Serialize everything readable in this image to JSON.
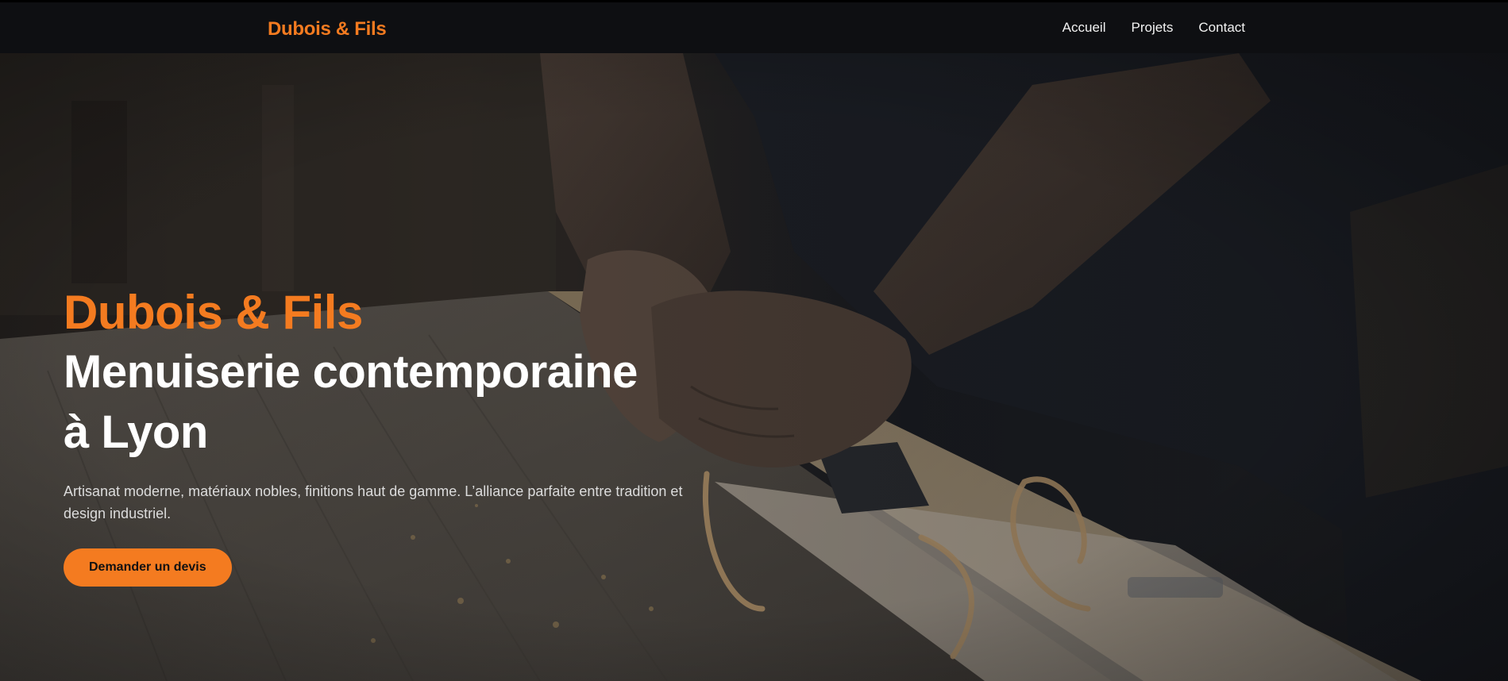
{
  "colors": {
    "accent": "#f47b20",
    "nav_background": "#0e0f12",
    "title_text": "#ffffff",
    "body_text": "#dcdcdc"
  },
  "navbar": {
    "brand": "Dubois & Fils",
    "links": [
      {
        "label": "Accueil"
      },
      {
        "label": "Projets"
      },
      {
        "label": "Contact"
      }
    ]
  },
  "hero": {
    "brand_heading": "Dubois & Fils",
    "title": "Menuiserie contemporaine à Lyon",
    "description": "Artisanat moderne, matériaux nobles, finitions haut de gamme. L’alliance parfaite entre tradition et design industriel.",
    "cta_label": "Demander un devis",
    "background_image": "carpenter-planing-wood-photo"
  }
}
